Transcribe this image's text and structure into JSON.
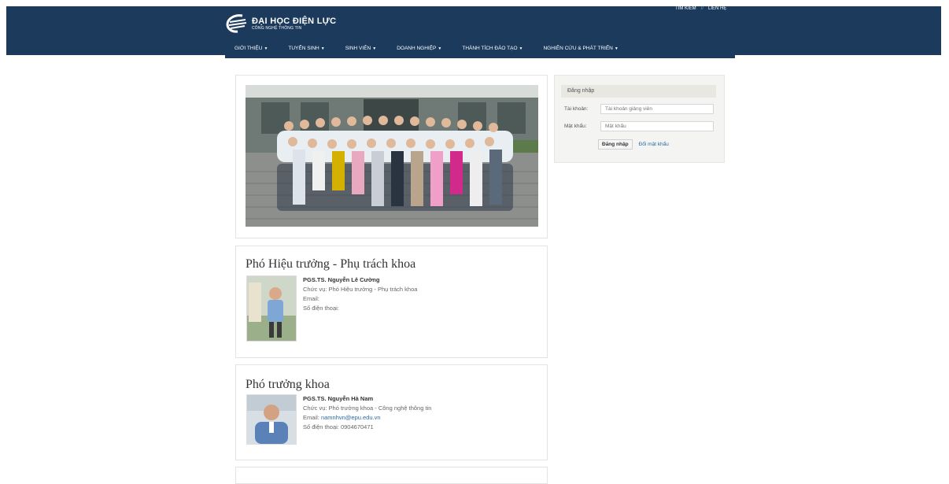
{
  "header": {
    "logo_title": "ĐẠI HỌC ĐIỆN LỰC",
    "logo_subtitle": "CÔNG NGHỆ THÔNG TIN",
    "top_links": [
      "TÌM KIẾM",
      "LIÊN HỆ"
    ],
    "top_link_separator": "//",
    "nav": [
      "GIỚI THIỆU",
      "TUYỂN SINH",
      "SINH VIÊN",
      "DOANH NGHIỆP",
      "THÀNH TÍCH ĐÀO TẠO",
      "NGHIÊN CỨU & PHÁT TRIỂN"
    ],
    "colors": {
      "header_bg": "#1b3a5c",
      "link": "#2a6aa8"
    }
  },
  "login": {
    "title": "Đăng nhập",
    "username_label": "Tài khoản:",
    "username_placeholder": "Tài khoản giảng viên",
    "password_label": "Mật khẩu:",
    "password_placeholder": "Mật khẩu",
    "submit_label": "Đăng nhập",
    "change_password_label": "Đổi mật khẩu"
  },
  "staff": [
    {
      "section_title": "Phó Hiệu trưởng - Phụ trách khoa",
      "name": "PGS.TS. Nguyễn Lê Cường",
      "position": "Chức vụ: Phó Hiệu trưởng - Phụ trách khoa",
      "email_label": "Email:",
      "email": "",
      "phone_label": "Số điện thoại:",
      "phone": ""
    },
    {
      "section_title": "Phó trưởng khoa",
      "name": "PGS.TS. Nguyễn Hà Nam",
      "position": "Chức vụ: Phó trưởng khoa - Công nghệ thông tin",
      "email_label": "Email:",
      "email": "namnhvn@epu.edu.vn",
      "phone_label": "Số điện thoại:",
      "phone": "0904670471"
    }
  ]
}
